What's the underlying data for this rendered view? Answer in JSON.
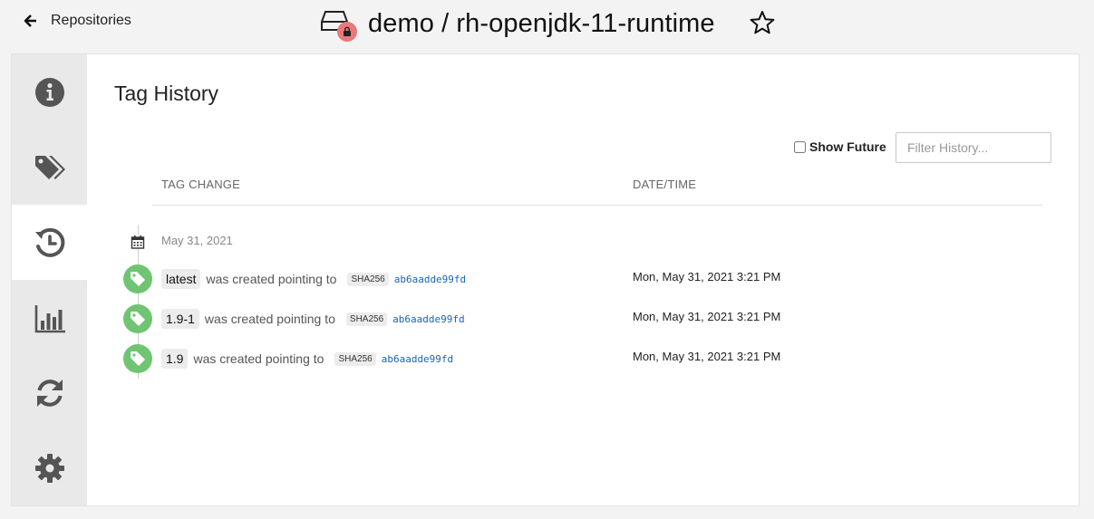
{
  "header": {
    "back_label": "Repositories",
    "repo_title": "demo / rh-openjdk-11-runtime"
  },
  "sidebar": {
    "items": [
      {
        "name": "info",
        "icon": "info-icon",
        "active": false
      },
      {
        "name": "tags",
        "icon": "tags-icon",
        "active": false
      },
      {
        "name": "history",
        "icon": "history-icon",
        "active": true
      },
      {
        "name": "usage",
        "icon": "bar-chart-icon",
        "active": false
      },
      {
        "name": "mirroring",
        "icon": "refresh-icon",
        "active": false
      },
      {
        "name": "settings",
        "icon": "gear-icon",
        "active": false
      }
    ]
  },
  "main": {
    "title": "Tag History",
    "show_future_label": "Show Future",
    "filter_placeholder": "Filter History...",
    "columns": {
      "tag_change": "TAG CHANGE",
      "datetime": "DATE/TIME"
    },
    "date_group": "May 31, 2021",
    "entries": [
      {
        "tag": "latest",
        "action": "was created pointing to",
        "sha_label": "SHA256",
        "digest": "ab6aadde99fd",
        "time": "Mon, May 31, 2021 3:21 PM"
      },
      {
        "tag": "1.9-1",
        "action": "was created pointing to",
        "sha_label": "SHA256",
        "digest": "ab6aadde99fd",
        "time": "Mon, May 31, 2021 3:21 PM"
      },
      {
        "tag": "1.9",
        "action": "was created pointing to",
        "sha_label": "SHA256",
        "digest": "ab6aadde99fd",
        "time": "Mon, May 31, 2021 3:21 PM"
      }
    ]
  },
  "colors": {
    "sidebar_bg": "#e9e9e9",
    "icon_gray": "#555555",
    "tag_green": "#6fc571",
    "lock_badge": "#e8787a",
    "digest_link": "#1a63b5"
  }
}
